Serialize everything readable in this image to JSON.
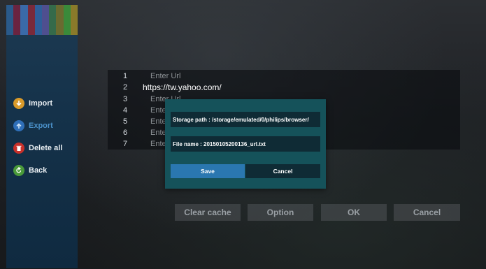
{
  "sidebar": {
    "stripe_colors": [
      "#2a5a8a",
      "#6a2440",
      "#3a6aa8",
      "#7a2a3a",
      "#2f5f9a",
      "#4f4f8f",
      "#356a4a",
      "#6a6a30",
      "#3a8a3a",
      "#8a7a2a"
    ],
    "items": [
      {
        "label": "Import",
        "icon": "import-icon",
        "color": "#d99a2a",
        "enabled": true
      },
      {
        "label": "Export",
        "icon": "export-icon",
        "color": "#2f6fb8",
        "enabled": false
      },
      {
        "label": "Delete all",
        "icon": "trash-icon",
        "color": "#c8302a",
        "enabled": true
      },
      {
        "label": "Back",
        "icon": "back-icon",
        "color": "#4a9a3a",
        "enabled": true
      }
    ]
  },
  "url_list": {
    "rows": [
      {
        "num": "1",
        "value": "Enter Url",
        "filled": false
      },
      {
        "num": "2",
        "value": "https://tw.yahoo.com/",
        "filled": true
      },
      {
        "num": "3",
        "value": "Enter Url",
        "filled": false
      },
      {
        "num": "4",
        "value": "Ente",
        "filled": false
      },
      {
        "num": "5",
        "value": "Ente",
        "filled": false
      },
      {
        "num": "6",
        "value": "Ente",
        "filled": false
      },
      {
        "num": "7",
        "value": "Ente",
        "filled": false
      }
    ]
  },
  "bottom_buttons": [
    "Clear cache",
    "Option",
    "OK",
    "Cancel"
  ],
  "dialog": {
    "storage_path": "Storage path : /storage/emulated/0/philips/browser/",
    "file_name": "File name : 20150105200136_url.txt",
    "save_label": "Save",
    "cancel_label": "Cancel"
  }
}
